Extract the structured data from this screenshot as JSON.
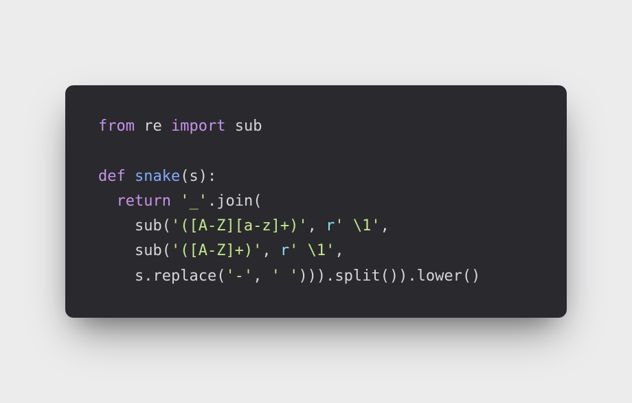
{
  "code": {
    "line1": {
      "from_kw": "from",
      "re_mod": "re",
      "import_kw": "import",
      "sub_id": "sub"
    },
    "line2": "",
    "line3": {
      "def_kw": "def",
      "fn_name": "snake",
      "paren_open": "(",
      "param": "s",
      "paren_close_colon": "):"
    },
    "line4": {
      "indent": "  ",
      "return_kw": "return",
      "space": " ",
      "str_underscore": "'_'",
      "dot_join_open": ".join("
    },
    "line5": {
      "indent": "    ",
      "sub_call": "sub(",
      "pattern": "'([A-Z][a-z]+)'",
      "comma_sp": ", ",
      "r_prefix": "r",
      "raw_str": "' \\\\1'",
      "comma": ","
    },
    "line6": {
      "indent": "    ",
      "sub_call": "sub(",
      "pattern": "'([A-Z]+)'",
      "comma_sp": ", ",
      "r_prefix": "r",
      "raw_str": "' \\\\1'",
      "comma": ","
    },
    "line7": {
      "indent": "    ",
      "s_replace": "s.replace(",
      "dash_str": "'-'",
      "comma_sp": ", ",
      "space_str": "' '",
      "tail": "))).split()).lower()"
    }
  }
}
